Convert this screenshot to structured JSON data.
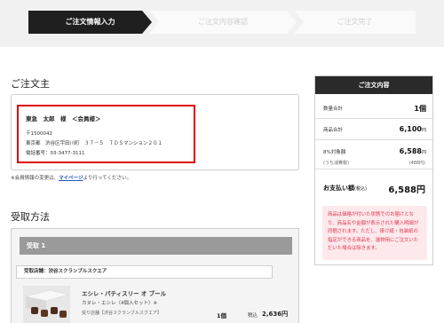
{
  "steps": [
    {
      "label": "ご注文情報入力",
      "state": "active"
    },
    {
      "label": "ご注文内容確認",
      "state": "inactive"
    },
    {
      "label": "ご注文完了",
      "state": "inactive"
    }
  ],
  "orderer": {
    "section_title": "ご注文主",
    "name": "東急　太郎　様　＜会員様＞",
    "postal": "〒1500042",
    "address": "東京都　渋谷区宇田川町　３７－５　ＴＤＳマンション２０１",
    "phone": "電話番号：03-3477-3111",
    "note_prefix": "※会員情報の変更は、",
    "note_link": "マイページ",
    "note_suffix": "より行ってください。"
  },
  "receipt": {
    "section_title": "受取方法",
    "header": "受取 1",
    "store": "受取店舗：渋谷スクランブルスクエア",
    "product": {
      "name": "エシレ・パティスリー オ ブール",
      "variant": "カヌレ・エシレ（4個入セット）※",
      "store": "受り店舗【渋谷スクランブルスクエア】",
      "qty": "1個",
      "price_label": "税込",
      "price": "2,636円"
    }
  },
  "summary": {
    "title": "ご注文内容",
    "quantity_label": "数量合計",
    "quantity_value": "1個",
    "items_label": "商品合計",
    "items_value": "6,100",
    "tax_label": "8%対象額",
    "tax_sub": "(うち消費税)",
    "tax_value": "6,588",
    "tax_sub_value": "(488円)",
    "total_label": "お支払い額",
    "total_suffix": "(税込)",
    "total_value": "6,588円",
    "yen": "円",
    "warning": "商品は価格が付いた状態でのお届けとなり、商品名や金額が表示された購入明細が同梱されます。ただし、掛け紙・包装紙の指定ができる商品を、進物用にご注文いただいた場合は除きます。"
  }
}
